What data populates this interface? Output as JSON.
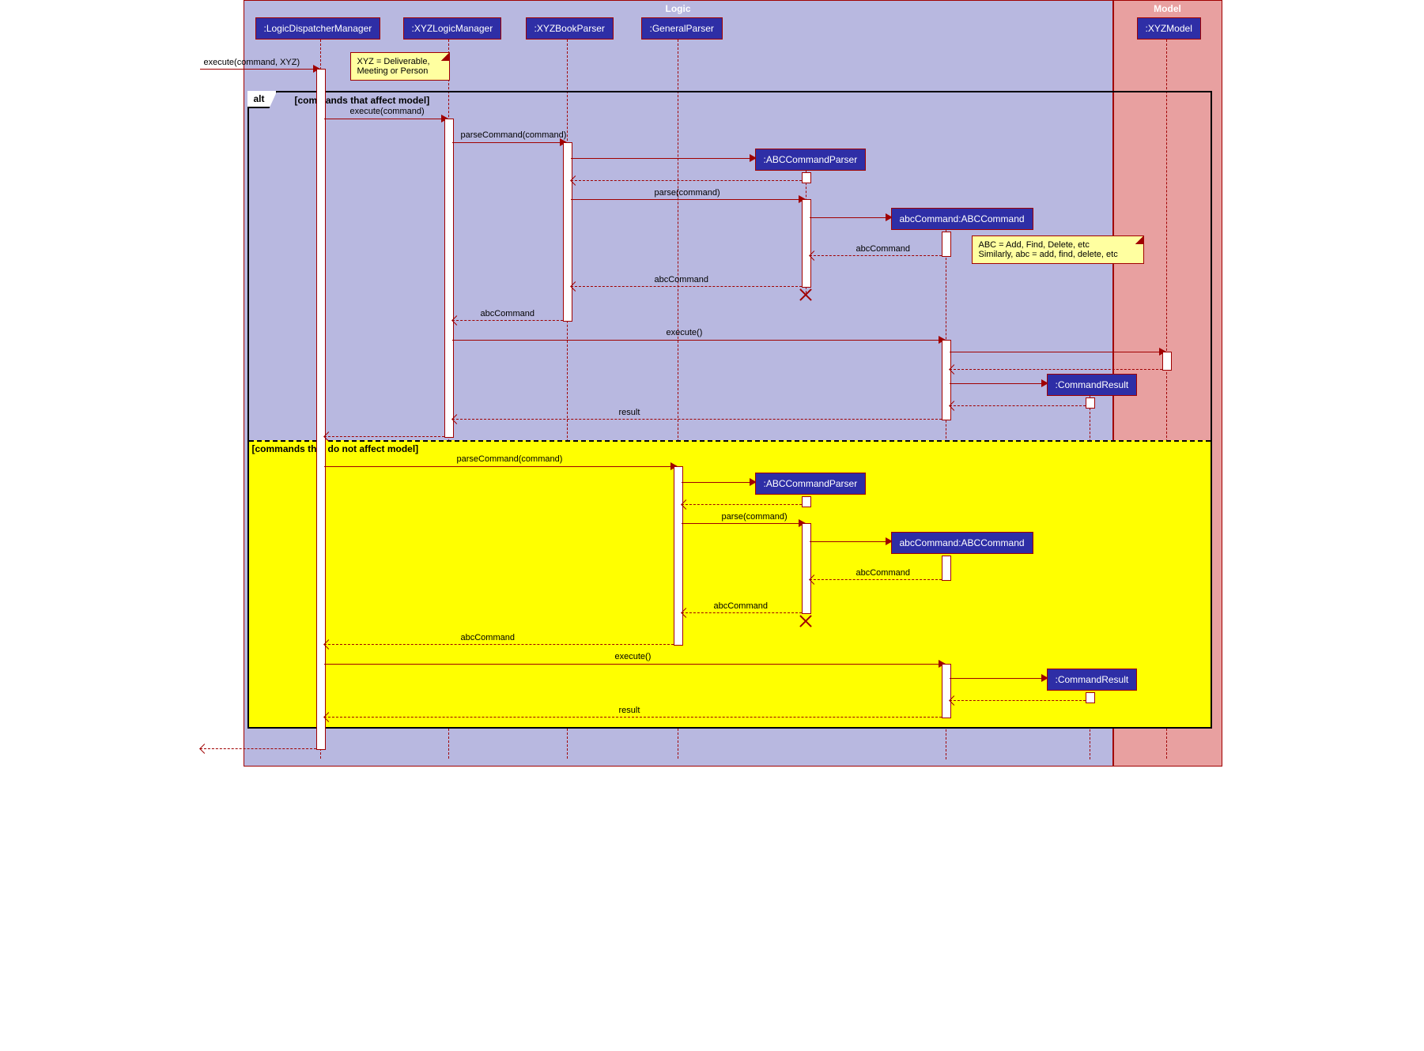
{
  "regions": {
    "logic": "Logic",
    "model": "Model"
  },
  "participants": {
    "dispatcher": ":LogicDispatcherManager",
    "xyzlogic": ":XYZLogicManager",
    "bookparser": ":XYZBookParser",
    "generalparser": ":GeneralParser",
    "xyzmodel": ":XYZModel",
    "abcparser1": ":ABCCommandParser",
    "abccommand1": "abcCommand:ABCCommand",
    "cmdresult1": ":CommandResult",
    "abcparser2": ":ABCCommandParser",
    "abccommand2": "abcCommand:ABCCommand",
    "cmdresult2": ":CommandResult"
  },
  "alt": {
    "label": "alt",
    "guard1": "[commands that affect model]",
    "guard2": "[commands that do not affect model]"
  },
  "notes": {
    "n1": "XYZ = Deliverable,\nMeeting or Person",
    "n2": "ABC = Add, Find, Delete, etc\nSimilarly, abc = add, find, delete, etc"
  },
  "messages": {
    "m1": "execute(command, XYZ)",
    "m2": "execute(command)",
    "m3": "parseCommand(command)",
    "m4": "parse(command)",
    "m5": "abcCommand",
    "m6": "abcCommand",
    "m7": "abcCommand",
    "m8": "execute()",
    "m9": "result",
    "m10": "parseCommand(command)",
    "m11": "parse(command)",
    "m12": "abcCommand",
    "m13": "abcCommand",
    "m14": "abcCommand",
    "m15": "execute()",
    "m16": "result"
  }
}
